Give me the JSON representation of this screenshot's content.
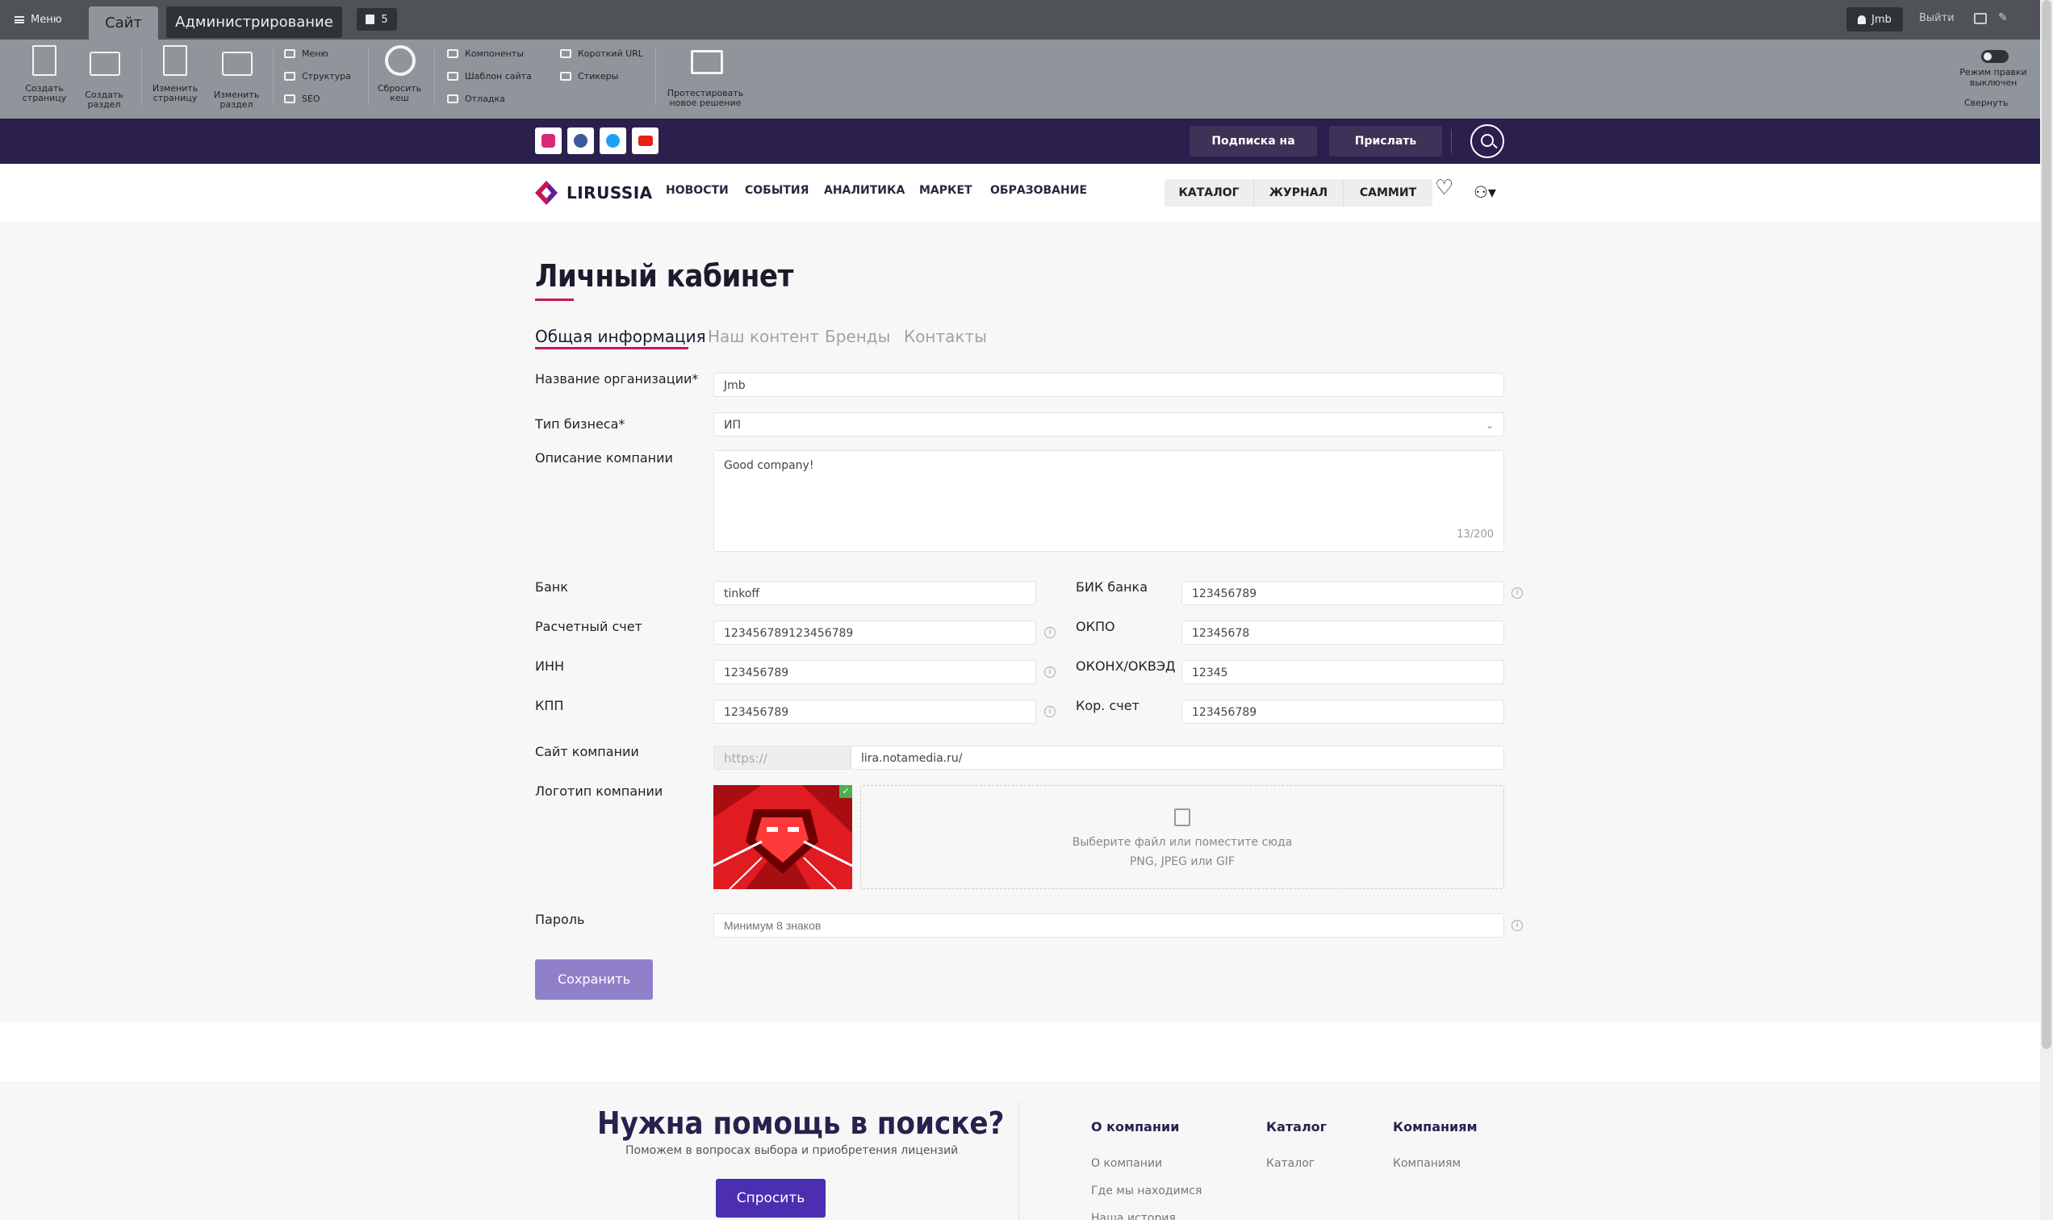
{
  "admin_bar": {
    "menu_label": "Меню",
    "tab_site": "Сайт",
    "tab_admin": "Администрирование",
    "notifications_count": "5",
    "user_name": "Jmb",
    "logout_label": "Выйти"
  },
  "toolbar": {
    "create_page": "Создать страницу",
    "create_section": "Создать раздел",
    "edit_page": "Изменить страницу",
    "edit_section": "Изменить раздел",
    "menu": "Меню",
    "structure": "Структура",
    "seo": "SEO",
    "reset_cache": "Сбросить кеш",
    "components": "Компоненты",
    "site_template": "Шаблон сайта",
    "debug": "Отладка",
    "short_url": "Короткий URL",
    "stickers": "Стикеры",
    "test_solution": "Протестировать новое решение",
    "edit_mode": "Режим правки выключен",
    "collapse": "Свернуть"
  },
  "topbar": {
    "subscribe": "Подписка на новости",
    "send_news": "Прислать новость"
  },
  "nav": {
    "logo": "LIRUSSIA",
    "links": [
      "НОВОСТИ",
      "СОБЫТИЯ",
      "АНАЛИТИКА",
      "МАРКЕТ",
      "ОБРАЗОВАНИЕ"
    ],
    "segments": [
      "КАТАЛОГ",
      "ЖУРНАЛ",
      "САММИТ"
    ]
  },
  "page": {
    "title": "Личный кабинет",
    "tabs": [
      "Общая информация",
      "Наш контент",
      "Бренды",
      "Контакты"
    ]
  },
  "form": {
    "org_name_label": "Название организации*",
    "org_name_value": "Jmb",
    "business_type_label": "Тип бизнеса*",
    "business_type_value": "ИП",
    "description_label": "Описание компании",
    "description_value": "Good company!",
    "description_counter": "13/200",
    "bank_label": "Банк",
    "bank_value": "tinkoff",
    "bik_label": "БИК банка",
    "bik_value": "123456789",
    "account_label": "Расчетный счет",
    "account_value": "123456789123456789",
    "okpo_label": "ОКПО",
    "okpo_value": "12345678",
    "inn_label": "ИНН",
    "inn_value": "123456789",
    "okonh_label": "ОКОНХ/ОКВЭД",
    "okonh_value": "12345",
    "kpp_label": "КПП",
    "kpp_value": "123456789",
    "corr_label": "Кор. счет",
    "corr_value": "123456789",
    "site_label": "Сайт компании",
    "site_prefix": "https://",
    "site_value": "lira.notamedia.ru/",
    "logo_label": "Логотип компании",
    "upload_text": "Выберите файл или поместите сюда",
    "upload_formats": "PNG, JPEG или GIF",
    "password_label": "Пароль",
    "password_placeholder": "Минимум 8 знаков",
    "save_label": "Сохранить"
  },
  "footer": {
    "help_title": "Нужна помощь в поиске?",
    "help_sub": "Поможем в вопросах выбора и приобретения лицензий",
    "ask_label": "Спросить",
    "col1_title": "О компании",
    "col1_links": [
      "О компании",
      "Где мы находимся",
      "Наша история"
    ],
    "col2_title": "Каталог",
    "col2_links": [
      "Каталог"
    ],
    "col3_title": "Компаниям",
    "col3_links": [
      "Компаниям"
    ]
  },
  "colors": {
    "accent": "#c2185b",
    "brand_purple": "#2a1f4d",
    "button_purple": "#8f80c9"
  }
}
